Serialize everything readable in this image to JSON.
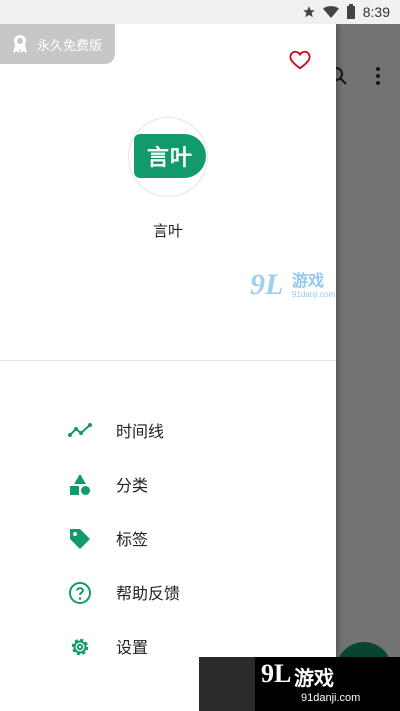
{
  "status_bar": {
    "time": "8:39"
  },
  "drawer": {
    "badge_label": "永久免费版",
    "app_name": "言叶",
    "avatar_text": "言叶",
    "menu": [
      {
        "label": "时间线",
        "icon": "timeline-icon"
      },
      {
        "label": "分类",
        "icon": "category-icon"
      },
      {
        "label": "标签",
        "icon": "tag-icon"
      },
      {
        "label": "帮助反馈",
        "icon": "help-icon"
      },
      {
        "label": "设置",
        "icon": "settings-icon"
      }
    ]
  },
  "watermark": {
    "name": "91游戏",
    "url": "91danji.com",
    "number": "9L",
    "brand": "游戏"
  },
  "colors": {
    "accent": "#129a6b",
    "heart": "#d0021b",
    "scrim": "rgba(0,0,0,0.55)"
  }
}
